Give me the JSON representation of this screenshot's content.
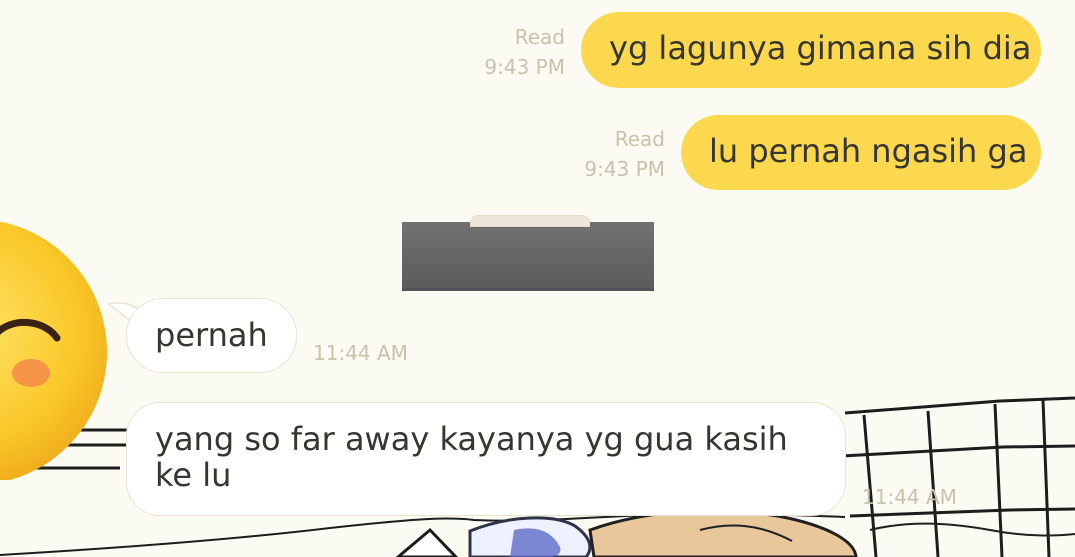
{
  "messages": [
    {
      "direction": "outgoing",
      "text": "yg lagunya gimana sih dia",
      "status": "Read",
      "time": "9:43 PM"
    },
    {
      "direction": "outgoing",
      "text": "lu pernah ngasih ga",
      "status": "Read",
      "time": "9:43 PM"
    },
    {
      "direction": "incoming",
      "text": "pernah",
      "time": "11:44 AM"
    },
    {
      "direction": "incoming",
      "text": "yang so far away kayanya yg gua kasih ke lu",
      "time": "11:44 AM"
    }
  ],
  "colors": {
    "background": "#fcfbf3",
    "outgoing_bubble": "#fcd84e",
    "incoming_bubble": "#ffffff",
    "timestamp": "#c8c2aa",
    "redaction": "#656565"
  },
  "icons": {
    "contact_profile": "smiling-face-emoji"
  }
}
